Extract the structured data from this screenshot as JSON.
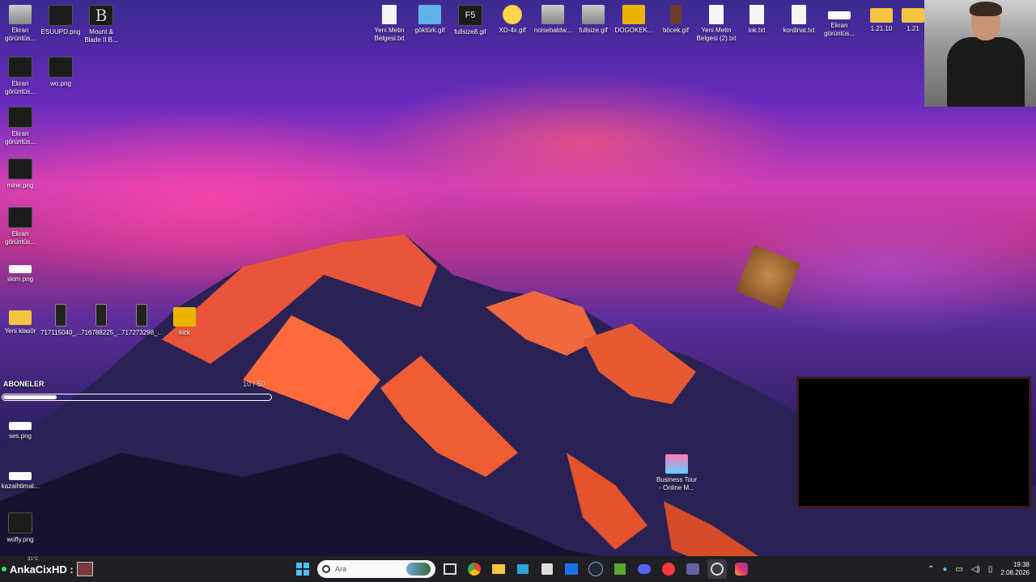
{
  "desktop_icons_left": [
    {
      "label": "Ekran görüntüs...",
      "type": "gray"
    },
    {
      "label": "ESUUPD.png",
      "type": "dark"
    },
    {
      "label": "Mount & Blade II B...",
      "type": "dark"
    },
    {
      "label": "Ekran görüntüs...",
      "type": "dark"
    },
    {
      "label": "wo.png",
      "type": "dark"
    },
    {
      "label": "Ekran görüntüs...",
      "type": "dark"
    },
    {
      "label": "mine.png",
      "type": "dark"
    },
    {
      "label": "Ekran görüntüs...",
      "type": "dark"
    },
    {
      "label": "skim.png",
      "type": "white"
    },
    {
      "label": "Yeni klasör",
      "type": "folder"
    },
    {
      "label": "717115040_...",
      "type": "phone"
    },
    {
      "label": "716788225_...",
      "type": "phone"
    },
    {
      "label": "717273298_...",
      "type": "phone"
    },
    {
      "label": "kick",
      "type": "yellow"
    },
    {
      "label": "ses.png",
      "type": "white"
    },
    {
      "label": "kazaihtimal...",
      "type": "white"
    },
    {
      "label": "wofly.png",
      "type": "dark"
    }
  ],
  "desktop_icons_top": [
    {
      "label": "Yeni Metin Belgesi.txt",
      "type": "file"
    },
    {
      "label": "göktürk.gif",
      "type": "file"
    },
    {
      "label": "fullsize8.gif",
      "type": "dark"
    },
    {
      "label": "XD-4x.gif",
      "type": "emoji"
    },
    {
      "label": "noisebaldw...",
      "type": "gray"
    },
    {
      "label": "fullsize.gif",
      "type": "gray"
    },
    {
      "label": "DOGOKEK...",
      "type": "yellow"
    },
    {
      "label": "böcek.gif",
      "type": "dark"
    },
    {
      "label": "Yeni Metin Belgesi (2).txt",
      "type": "file"
    },
    {
      "label": "lok.txt",
      "type": "file"
    },
    {
      "label": "kordinat.txt",
      "type": "file"
    },
    {
      "label": "Ekran görüntüs...",
      "type": "white"
    },
    {
      "label": "1.21.10",
      "type": "folder"
    },
    {
      "label": "1.21",
      "type": "folder"
    }
  ],
  "desktop_icon_app": {
    "label": "Business Tour - Online M...",
    "type": "emoji"
  },
  "subscribers": {
    "label": "ABONELER",
    "count": "10 / 50",
    "progress": 0.2
  },
  "taskbar": {
    "username": "AnkaCixHD :",
    "temperature": "31°C",
    "search_placeholder": "Ara",
    "time": "19:38",
    "date": "2.08.2026"
  }
}
